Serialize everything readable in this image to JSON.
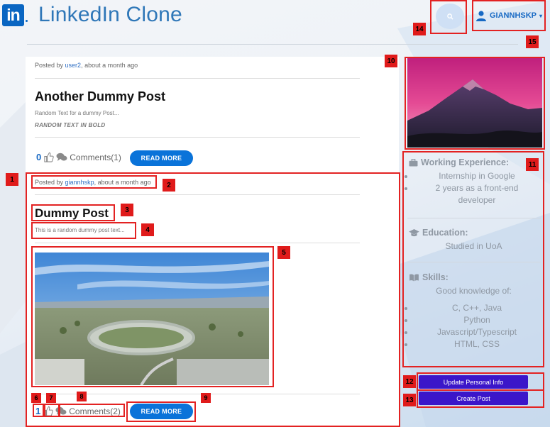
{
  "header": {
    "logo_text": "in",
    "brand": "LinkedIn Clone",
    "search_icon": "search-icon",
    "user_name": "GIANNHSKP",
    "user_icon": "user-icon",
    "caret": "▾"
  },
  "posts": [
    {
      "posted_by_prefix": "Posted by",
      "author": "user2",
      "time": ", about a month ago",
      "title": "Another Dummy Post",
      "text": "Random Text for a dummy Post...",
      "bold_text": "RANDOM TEXT IN BOLD",
      "likes": "0",
      "comments": "Comments(1)",
      "read_more": "READ MORE"
    },
    {
      "posted_by_prefix": "Posted by",
      "author": "giannhskp",
      "time": ", about a month ago",
      "title": "Dummy Post",
      "text": "This is a random dummy post text...",
      "likes": "1",
      "comments": "Comments(2)",
      "read_more": "READ MORE"
    }
  ],
  "sidebar": {
    "working_experience": {
      "heading": "Working Experience:",
      "items": [
        "Internship in Google",
        "2 years as a front-end developer"
      ]
    },
    "education": {
      "heading": "Education:",
      "text": "Studied in UoA"
    },
    "skills": {
      "heading": "Skills:",
      "intro": "Good knowledge of:",
      "items": [
        "C, C++, Java",
        "Python",
        "Javascript/Typescript",
        "HTML, CSS"
      ]
    },
    "update_button": "Update Personal Info",
    "create_button": "Create Post"
  },
  "annotations": [
    "1",
    "2",
    "3",
    "4",
    "5",
    "6",
    "7",
    "8",
    "9",
    "10",
    "11",
    "12",
    "13",
    "14",
    "15"
  ],
  "colors": {
    "brand": "#2f77b8",
    "accent": "#0a73d9",
    "purple_button": "#3b16c9",
    "annotation": "#e01b1b"
  }
}
